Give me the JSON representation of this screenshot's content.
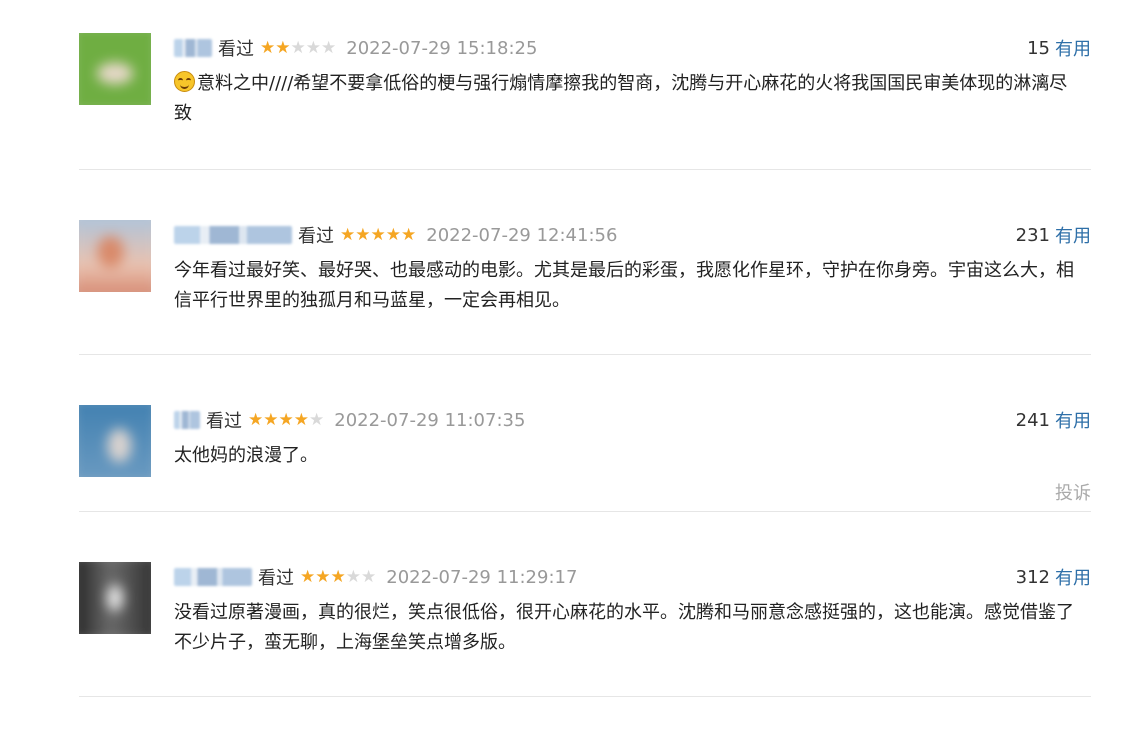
{
  "reviews": [
    {
      "watched": "看过",
      "rating": 2,
      "time": "2022-07-29 15:18:25",
      "useful_count": "15",
      "useful_label": "有用",
      "content": "意料之中////希望不要拿低俗的梗与强行煽情摩擦我的智商，沈腾与开心麻花的火将我国国民审美体现的淋漓尽致",
      "emoji": "smiling-face-icon",
      "username_blurred": true
    },
    {
      "watched": "看过",
      "rating": 5,
      "time": "2022-07-29 12:41:56",
      "useful_count": "231",
      "useful_label": "有用",
      "content": "今年看过最好笑、最好哭、也最感动的电影。尤其是最后的彩蛋，我愿化作星环，守护在你身旁。宇宙这么大，相信平行世界里的独孤月和马蓝星，一定会再相见。",
      "username_blurred": true
    },
    {
      "watched": "看过",
      "rating": 4,
      "time": "2022-07-29 11:07:35",
      "useful_count": "241",
      "useful_label": "有用",
      "content": "太他妈的浪漫了。",
      "report_label": "投诉",
      "username_blurred": true
    },
    {
      "watched": "看过",
      "rating": 3,
      "time": "2022-07-29 11:29:17",
      "useful_count": "312",
      "useful_label": "有用",
      "content": "没看过原著漫画，真的很烂，笑点很低俗，很开心麻花的水平。沈腾和马丽意念感挺强的，这也能演。感觉借鉴了不少片子，蛮无聊，上海堡垒笑点增多版。",
      "username_blurred": true
    }
  ],
  "colors": {
    "star_on": "#f5a623",
    "star_off": "#d9d9d9",
    "useful_link": "#2e6fa8",
    "timestamp": "#999999",
    "divider": "#e6e6e6"
  }
}
